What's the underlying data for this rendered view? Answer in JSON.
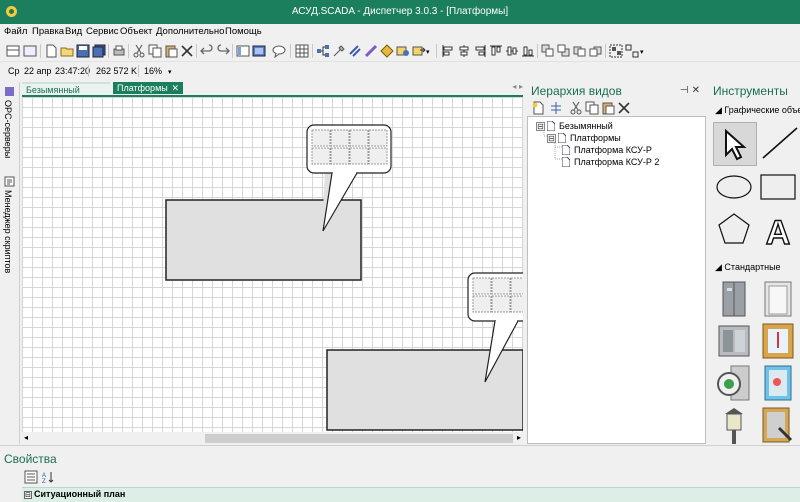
{
  "window": {
    "title": "АСУД.SCADA - Диспетчер 3.0.3 - [Платформы]"
  },
  "menu": [
    "Файл",
    "Правка",
    "Вид",
    "Сервис",
    "Объект",
    "Дополнительно",
    "Помощь"
  ],
  "status": {
    "day": "Ср",
    "date": "22 апр",
    "time": "23:47:20",
    "memory": "262 572 K",
    "zoom": "16%"
  },
  "side_tabs": [
    "OPC-серверы",
    "Менеджер скриптов"
  ],
  "doc_tabs": [
    "Безымянный",
    "Платформы"
  ],
  "doc_tab_close": "✕",
  "hierarchy": {
    "title": "Иерархия видов",
    "pin": "⊣",
    "close": "✕",
    "tree": [
      {
        "label": "Безымянный",
        "expander": "⊟"
      },
      {
        "label": "Платформы",
        "expander": "⊟"
      },
      {
        "label": "Платформа КСУ-Р"
      },
      {
        "label": "Платформа КСУ-Р 2"
      }
    ]
  },
  "tools_panel": {
    "title": "Инструменты",
    "section_graphics": "Графические объе",
    "section_standard": "Стандартные",
    "graphics_tools": [
      "pointer-tool",
      "line-tool",
      "ellipse-tool",
      "rectangle-tool",
      "polygon-tool",
      "text-tool"
    ],
    "standard_tools": [
      "elevator-door-tool",
      "door-tool",
      "elevator-cabin-tool",
      "thermometer-panel-tool",
      "gauge-tool",
      "fire-panel-tool",
      "street-lamp-tool",
      "key-panel-tool"
    ],
    "text_glyph": "A"
  },
  "properties": {
    "title": "Свойства",
    "group": "Ситуационный план",
    "expander": "⊟"
  },
  "colors": {
    "accent": "#1b7f5d",
    "grid": "#d6d6d6",
    "shape_fill": "#e0e0e0"
  }
}
